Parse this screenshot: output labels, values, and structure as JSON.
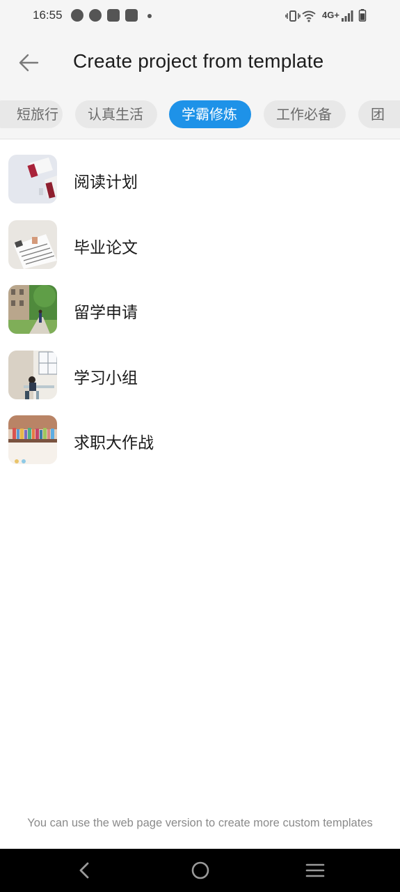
{
  "status_bar": {
    "time": "16:55",
    "network": "4G+",
    "notification_icons": [
      "message-icon",
      "compass-icon",
      "mail-icon",
      "mail-icon"
    ],
    "system_icons": [
      "vibrate-icon",
      "wifi-icon",
      "signal-icon",
      "battery-icon"
    ]
  },
  "header": {
    "title": "Create project from template",
    "back_icon": "arrow-left-icon"
  },
  "tabs": [
    {
      "label": "短途旅行",
      "visible_text": "短旅行",
      "active": false
    },
    {
      "label": "认真生活",
      "active": false
    },
    {
      "label": "学霸修炼",
      "active": true
    },
    {
      "label": "工作必备",
      "active": false
    },
    {
      "label": "团",
      "active": false
    }
  ],
  "templates": [
    {
      "name": "阅读计划",
      "thumb": "books-photo"
    },
    {
      "name": "毕业论文",
      "thumb": "paper-photo"
    },
    {
      "name": "留学申请",
      "thumb": "campus-photo"
    },
    {
      "name": "学习小组",
      "thumb": "study-room-photo"
    },
    {
      "name": "求职大作战",
      "thumb": "bookshelf-photo"
    }
  ],
  "footer": {
    "note": "You can use the web page version to create more custom templates"
  },
  "nav_bar": {
    "buttons": [
      "back-icon",
      "home-icon",
      "menu-icon"
    ]
  },
  "colors": {
    "accent": "#1e92e8",
    "header_bg": "#f5f5f5",
    "tab_bg": "#e8e8e8"
  }
}
